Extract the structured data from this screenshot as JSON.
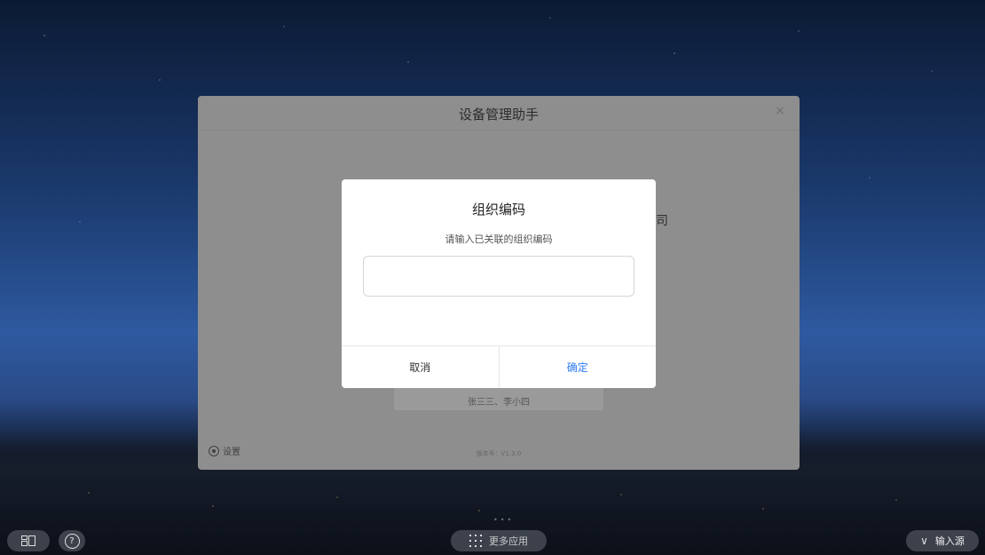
{
  "window": {
    "title": "设备管理助手",
    "close_glyph": "×",
    "company_fragment": "司",
    "members_text": "张三三、李小四",
    "settings_label": "设置",
    "version_text": "版本号：V1.3.0"
  },
  "dialog": {
    "title": "组织编码",
    "subtitle": "请输入已关联的组织编码",
    "input_value": "",
    "input_placeholder": "",
    "cancel_label": "取消",
    "confirm_label": "确定",
    "confirm_color": "#2b7bf5"
  },
  "taskbar": {
    "help_glyph": "?",
    "more_apps_label": "更多应用",
    "input_source_label": "输入源",
    "chevron_glyph": "∨",
    "pager_dots": "•••"
  }
}
